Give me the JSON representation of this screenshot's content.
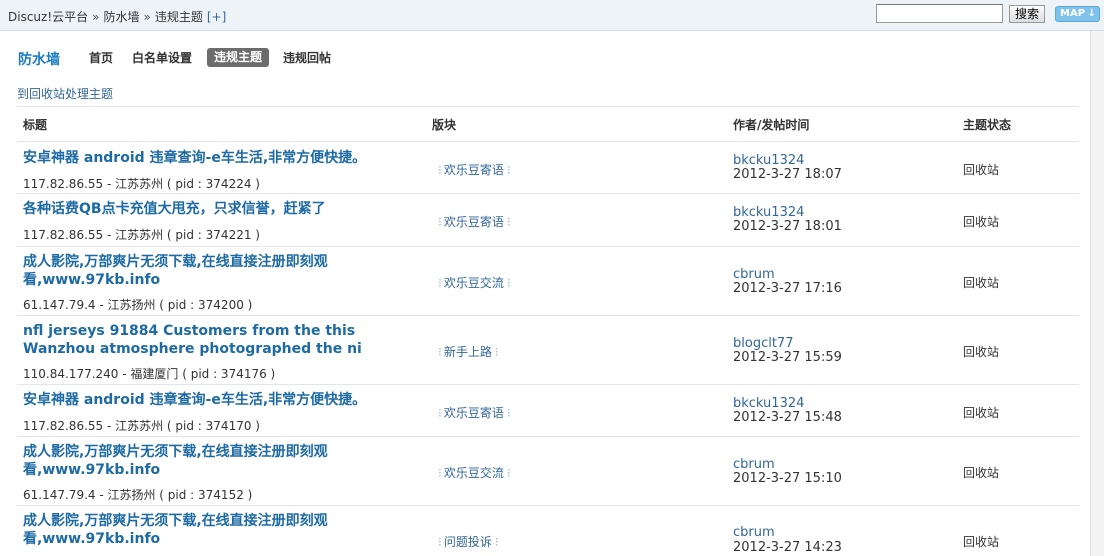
{
  "breadcrumb": {
    "items": [
      "Discuz!云平台",
      "防水墙",
      "违规主题"
    ],
    "separator": "»",
    "extra": "[+]"
  },
  "search": {
    "value": "",
    "button_label": "搜索"
  },
  "map_button": {
    "label": "MAP",
    "arrow": "↓"
  },
  "nav": {
    "title": "防水墙",
    "tabs": [
      {
        "label": "首页",
        "active": false
      },
      {
        "label": "白名单设置",
        "active": false
      },
      {
        "label": "违规主题",
        "active": true
      },
      {
        "label": "违规回帖",
        "active": false
      }
    ]
  },
  "recycle_link": "到回收站处理主题",
  "table": {
    "headers": [
      "标题",
      "版块",
      "作者/发帖时间",
      "主题状态"
    ],
    "rows": [
      {
        "title": "安卓神器 android 违章查询-e车生活,非常方便快捷。",
        "ip": "117.82.86.55 - 江苏苏州 ( pid : 374224 )",
        "forum": "欢乐豆寄语",
        "author": "bkcku1324",
        "time": "2012-3-27 18:07",
        "status": "回收站"
      },
      {
        "title": "各种话费QB点卡充值大甩充，只求信誉，赶紧了",
        "ip": "117.82.86.55 - 江苏苏州 ( pid : 374221 )",
        "forum": "欢乐豆寄语",
        "author": "bkcku1324",
        "time": "2012-3-27 18:01",
        "status": "回收站"
      },
      {
        "title": "成人影院,万部爽片无须下载,在线直接注册即刻观看,www.97kb.info",
        "ip": "61.147.79.4 - 江苏扬州 ( pid : 374200 )",
        "forum": "欢乐豆交流",
        "author": "cbrum",
        "time": "2012-3-27 17:16",
        "status": "回收站"
      },
      {
        "title": "nfl jerseys 91884 Customers from the this Wanzhou atmosphere photographed the ni",
        "ip": "110.84.177.240 - 福建厦门 ( pid : 374176 )",
        "forum": "新手上路",
        "author": "blogclt77",
        "time": "2012-3-27 15:59",
        "status": "回收站"
      },
      {
        "title": "安卓神器 android 违章查询-e车生活,非常方便快捷。",
        "ip": "117.82.86.55 - 江苏苏州 ( pid : 374170 )",
        "forum": "欢乐豆寄语",
        "author": "bkcku1324",
        "time": "2012-3-27 15:48",
        "status": "回收站"
      },
      {
        "title": "成人影院,万部爽片无须下载,在线直接注册即刻观看,www.97kb.info",
        "ip": "61.147.79.4 - 江苏扬州 ( pid : 374152 )",
        "forum": "欢乐豆交流",
        "author": "cbrum",
        "time": "2012-3-27 15:10",
        "status": "回收站"
      },
      {
        "title": "成人影院,万部爽片无须下载,在线直接注册即刻观看,www.97kb.info",
        "ip": "",
        "forum": "问题投诉",
        "author": "cbrum",
        "time": "2012-3-27 14:23",
        "status": "回收站"
      }
    ]
  }
}
